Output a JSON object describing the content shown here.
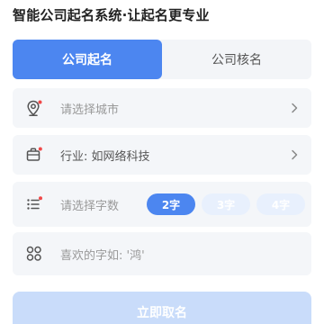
{
  "title": "智能公司起名系统·让起名更专业",
  "tabs": [
    {
      "label": "公司起名",
      "active": true
    },
    {
      "label": "公司核名",
      "active": false
    }
  ],
  "form": {
    "city": {
      "placeholder": "请选择城市",
      "icon": "location-pin-icon"
    },
    "industry": {
      "value": "行业: 如网络科技",
      "icon": "briefcase-icon"
    },
    "word_count": {
      "placeholder": "请选择字数",
      "icon": "list-icon",
      "options": [
        {
          "label": "2字",
          "selected": true
        },
        {
          "label": "3字",
          "selected": false
        },
        {
          "label": "4字",
          "selected": false
        }
      ]
    },
    "preferred_char": {
      "placeholder": "喜欢的字如: '鸿'",
      "icon": "grid-icon"
    }
  },
  "submit_label": "立即取名",
  "colors": {
    "accent": "#4c86f0",
    "accent_light": "#e8f0fd",
    "row_bg": "#f4f6f9",
    "required_dot": "#f04848"
  }
}
